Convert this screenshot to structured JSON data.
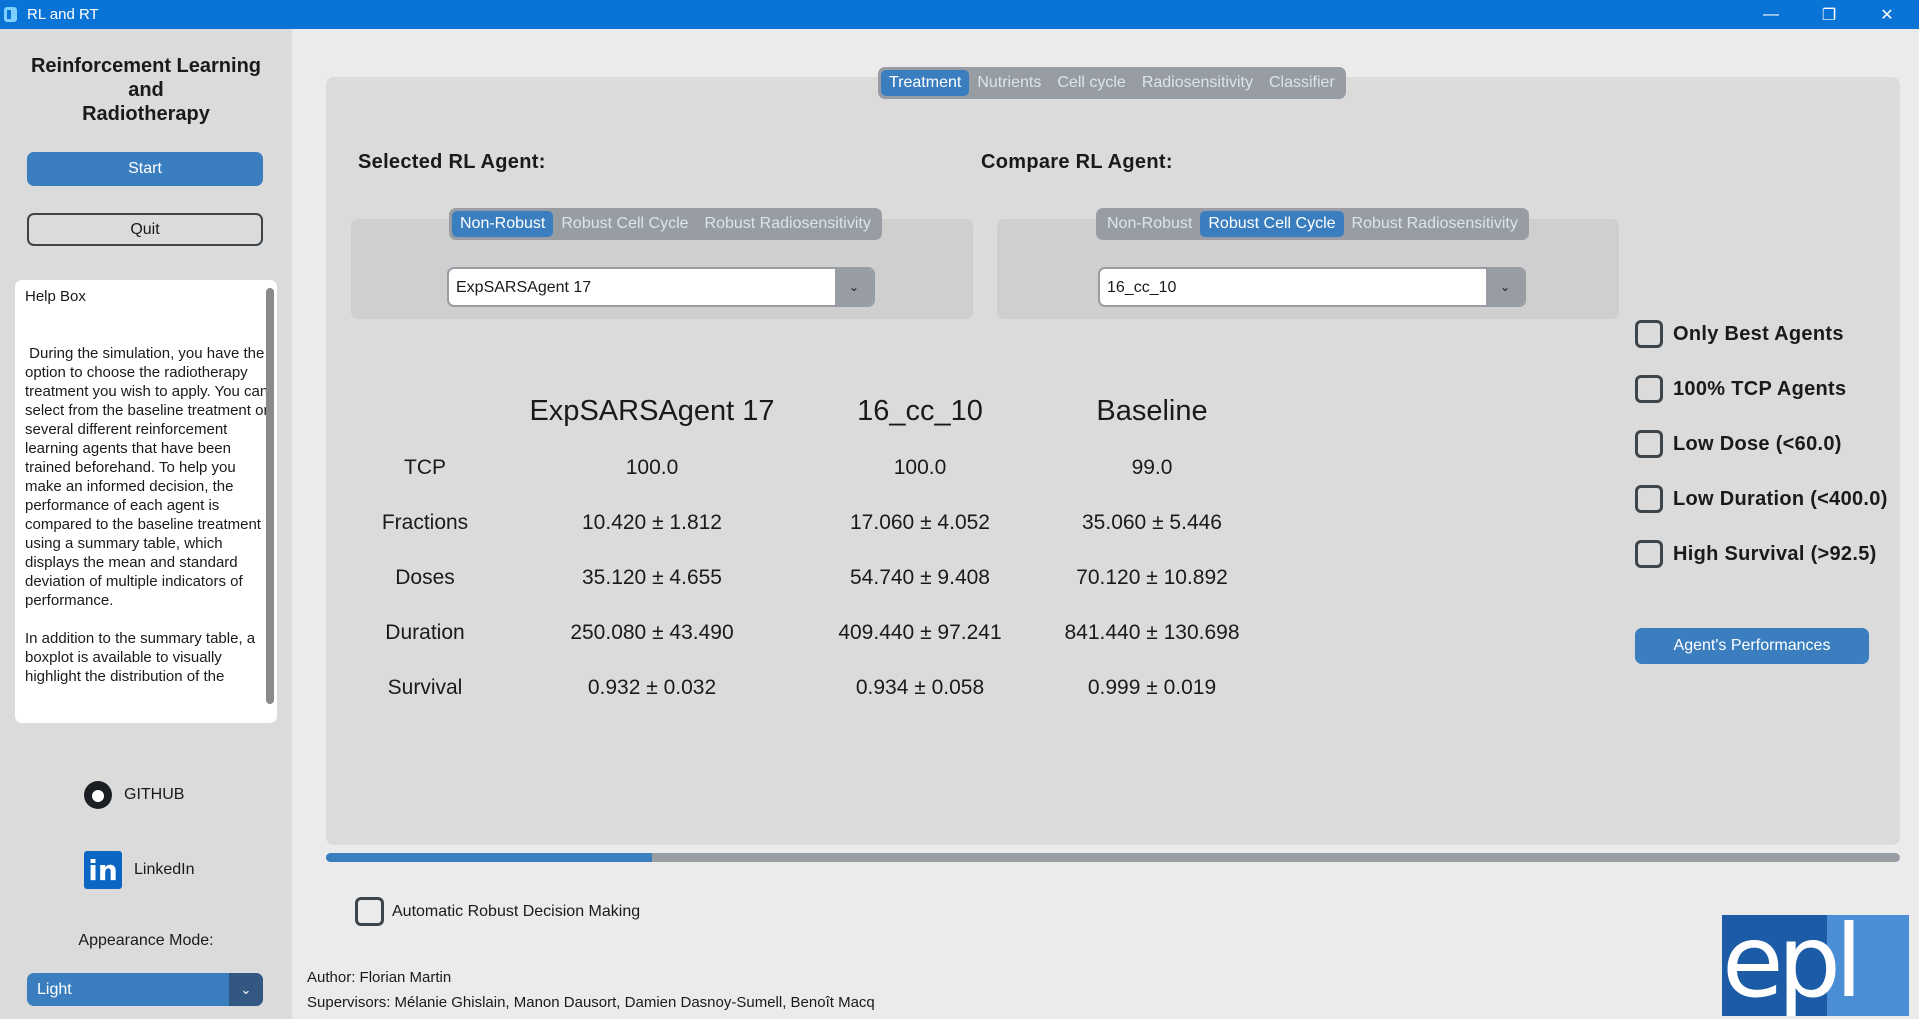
{
  "window": {
    "title": "RL and RT",
    "minimize": "—",
    "restore": "❐",
    "close": "✕"
  },
  "sidebar": {
    "heading_line1": "Reinforcement Learning",
    "heading_line2": "and",
    "heading_line3": "Radiotherapy",
    "start_label": "Start",
    "quit_label": "Quit",
    "help_title": "Help Box",
    "help_text": " During the simulation, you have the option to choose the radiotherapy treatment you wish to apply. You can select from the baseline treatment or several different reinforcement learning agents that have been trained beforehand. To help you make an informed decision, the performance of each agent is compared to the baseline treatment using a summary table, which displays the mean and standard deviation of multiple indicators of performance.\n\nIn addition to the summary table, a boxplot is available to visually highlight the distribution of the",
    "github_label": "GITHUB",
    "linkedin_label": "LinkedIn",
    "linkedin_glyph": "in",
    "appearance_label": "Appearance Mode:",
    "appearance_value": "Light"
  },
  "tabs": [
    "Treatment",
    "Nutrients",
    "Cell cycle",
    "Radiosensitivity",
    "Classifier"
  ],
  "selected": {
    "label": "Selected RL Agent:",
    "options": [
      "Non-Robust",
      "Robust Cell Cycle",
      "Robust Radiosensitivity"
    ],
    "active_option": "Non-Robust",
    "agent": "ExpSARSAgent 17"
  },
  "compare": {
    "label": "Compare RL Agent:",
    "options": [
      "Non-Robust",
      "Robust Cell Cycle",
      "Robust Radiosensitivity"
    ],
    "active_option": "Robust Cell Cycle",
    "agent": "16_cc_10"
  },
  "table": {
    "columns": [
      "ExpSARSAgent 17",
      "16_cc_10",
      "Baseline"
    ],
    "rows": [
      {
        "label": "TCP",
        "values": [
          "100.0",
          "100.0",
          "99.0"
        ]
      },
      {
        "label": "Fractions",
        "values": [
          "10.420 ± 1.812",
          "17.060 ± 4.052",
          "35.060 ± 5.446"
        ]
      },
      {
        "label": "Doses",
        "values": [
          "35.120 ± 4.655",
          "54.740 ± 9.408",
          "70.120 ± 10.892"
        ]
      },
      {
        "label": "Duration",
        "values": [
          "250.080 ± 43.490",
          "409.440 ± 97.241",
          "841.440 ± 130.698"
        ]
      },
      {
        "label": "Survival",
        "values": [
          "0.932 ± 0.032",
          "0.934 ± 0.058",
          "0.999 ± 0.019"
        ]
      }
    ]
  },
  "filters": [
    "Only Best Agents",
    "100% TCP Agents",
    "Low Dose (<60.0)",
    "Low Duration (<400.0)",
    "High Survival (>92.5)"
  ],
  "performances_label": "Agent's Performances",
  "progress": 0.207,
  "auto_robust_label": "Automatic Robust Decision Making",
  "author": "Author: Florian Martin",
  "supervisors": "Supervisors: Mélanie Ghislain, Manon Dausort, Damien Dasnoy-Sumell, Benoît Macq",
  "logo_text": "epl",
  "colors": {
    "accent": "#3a7ebf",
    "titlebar": "#0a74d6"
  }
}
